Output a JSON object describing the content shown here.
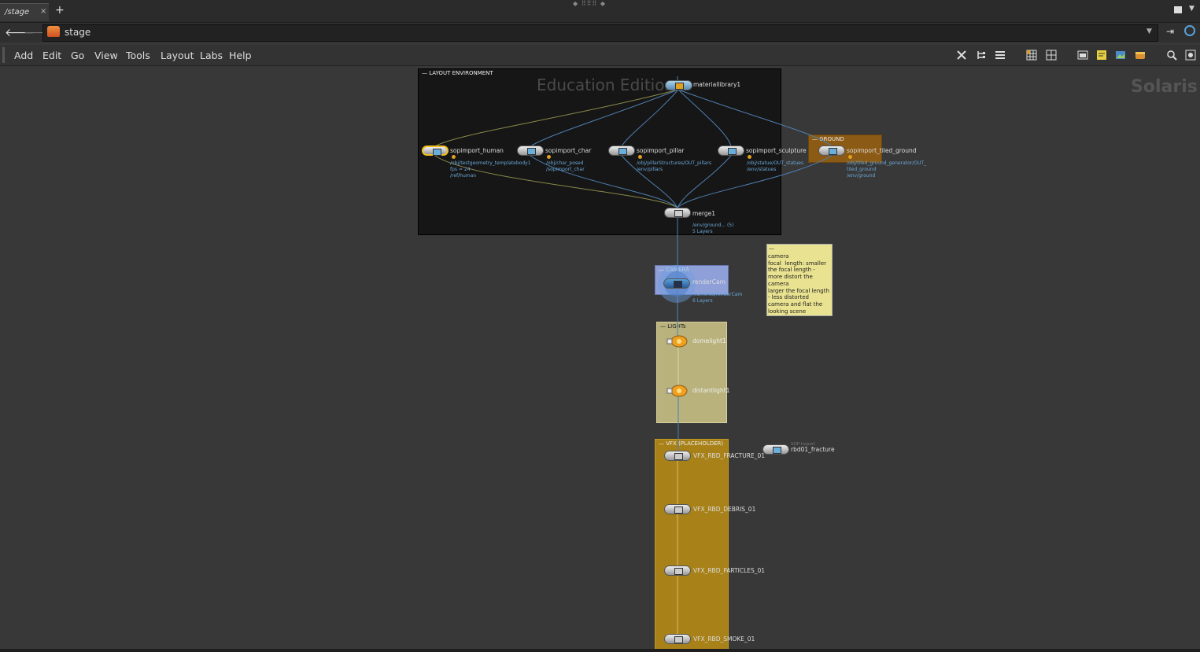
{
  "tabs": [
    {
      "label": "/stage",
      "close": "×"
    }
  ],
  "tab_add": "+",
  "path": {
    "label": "stage",
    "icon": "stage-icon"
  },
  "menu": [
    "Add",
    "Edit",
    "Go",
    "View",
    "Tools",
    "Layout",
    "Labs",
    "Help"
  ],
  "watermark": "Education Edition",
  "context_label": "Solaris",
  "network_boxes": {
    "layout": "LAYOUT ENVIRONMENT",
    "ground": "GROUND",
    "camera": "CAMERA",
    "lights": "LIGHTs",
    "vfx": "VFX (PLACEHOLDER)"
  },
  "nodes": {
    "materiallibrary1": "materiallibrary1",
    "sop_human": "sopimport_human",
    "sop_human_sub": [
      "/obj/testgeometry_templatebody1",
      "fps = 24",
      "/ref/human"
    ],
    "sop_char": "sopimport_char",
    "sop_char_sub": [
      "/obj/char_posed",
      "/sopimport_char"
    ],
    "sop_pillar": "sopimport_pillar",
    "sop_pillar_sub": [
      "/obj/pillarStructures/OUT_pillars",
      "/env/pillars"
    ],
    "sop_sculpture": "sopimport_sculpture",
    "sop_sculpture_sub": [
      "/obj/statue/OUT_statues",
      "/env/statues"
    ],
    "sop_ground": "sopimport_tiled_ground",
    "sop_ground_sub": [
      "/obj/tiled_ground_generator/OUT_",
      "tiled_ground",
      "/env/ground"
    ],
    "merge1": "merge1",
    "merge1_sub": [
      "/env/ground... (5)",
      "5 Layers"
    ],
    "rendercam": "renderCam",
    "rendercam_sub": [
      "/cameras/renderCam",
      "6 Layers"
    ],
    "domelight1": "domelight1",
    "distantlight1": "distantlight1",
    "vfx1": "VFX_RBD_FRACTURE_01",
    "vfx2": "VFX_RBD_DEBRIS_01",
    "vfx3": "VFX_RBD_PARTICLES_01",
    "vfx4": "VFX_RBD_SMOKE_01",
    "rbd": "rbd01_fracture",
    "rbd_top": "SOP Import"
  },
  "sticky_note": "camera\nfocal  length: smaller the focal length - more distort the camera\nlarger the focal length - less distorted camera and flat the looking scene",
  "colors": {
    "camera_box": "#8f9fd8",
    "lights_box": "#b9b27c",
    "vfx_box": "#a88118",
    "ground_box": "#8b5a14",
    "note": "#e9e290",
    "wire": "#4f7fb0"
  }
}
